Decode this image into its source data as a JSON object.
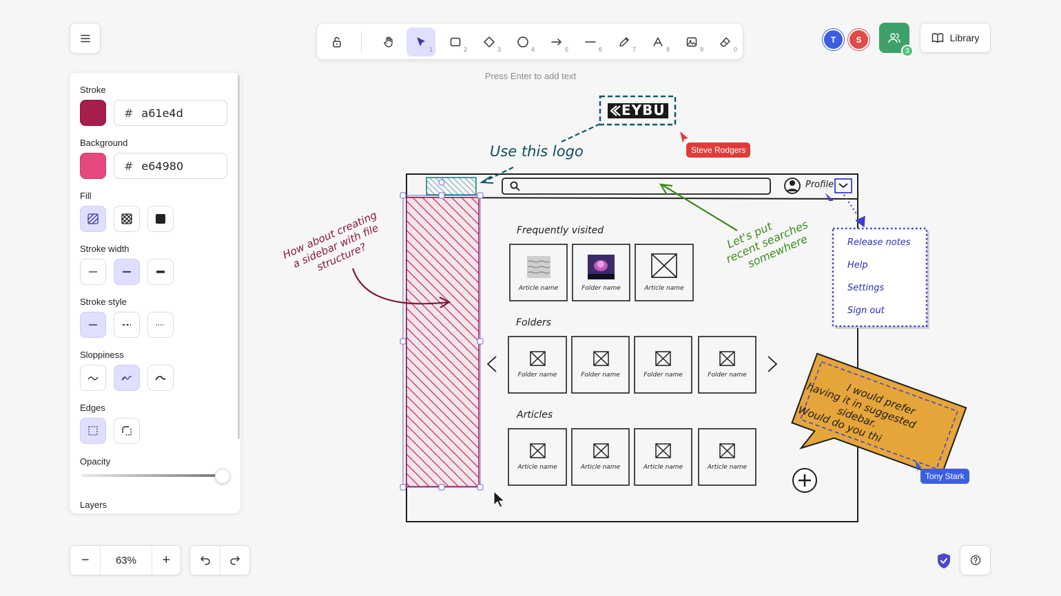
{
  "menu": {
    "icon": "hamburger-menu-icon"
  },
  "toolbar": {
    "tools": [
      {
        "name": "lock",
        "key": ""
      },
      {
        "name": "hand",
        "key": ""
      },
      {
        "name": "selection",
        "key": "1"
      },
      {
        "name": "rectangle",
        "key": "2"
      },
      {
        "name": "diamond",
        "key": "3"
      },
      {
        "name": "ellipse",
        "key": "4"
      },
      {
        "name": "arrow",
        "key": "5"
      },
      {
        "name": "line",
        "key": "6"
      },
      {
        "name": "draw",
        "key": "7"
      },
      {
        "name": "text",
        "key": "8"
      },
      {
        "name": "image",
        "key": "9"
      },
      {
        "name": "eraser",
        "key": "0"
      }
    ],
    "hint": "Press Enter to add text"
  },
  "collaborators": {
    "avatars": [
      {
        "initial": "T",
        "color": "#3b5fe0"
      },
      {
        "initial": "S",
        "color": "#e04b4b"
      }
    ],
    "share_count": "3",
    "share_color": "#3ea16b"
  },
  "library": {
    "label": "Library"
  },
  "panel": {
    "stroke_label": "Stroke",
    "stroke_hex": "a61e4d",
    "stroke_color": "#a61e4d",
    "background_label": "Background",
    "background_hex": "e64980",
    "background_color": "#e64980",
    "hash": "#",
    "fill_label": "Fill",
    "stroke_width_label": "Stroke width",
    "stroke_style_label": "Stroke style",
    "sloppiness_label": "Sloppiness",
    "edges_label": "Edges",
    "opacity_label": "Opacity",
    "opacity_value": 1.0,
    "layers_label": "Layers"
  },
  "zoom": {
    "value": "63%",
    "minus": "−",
    "plus": "+"
  },
  "canvas": {
    "logo_text": "EYBU",
    "use_logo": "Use this logo",
    "cursor_steve": "Steve Rodgers",
    "cursor_tony": "Tony Stark",
    "sidebar_note": [
      "How about creating",
      "a sidebar with file",
      "structure?"
    ],
    "searches_note": [
      "Let's put",
      "recent searches",
      "somewhere"
    ],
    "profile": "Profile",
    "dropdown": [
      "Release notes",
      "Help",
      "Settings",
      "Sign out"
    ],
    "sections": {
      "frequent": "Frequently visited",
      "folders": "Folders",
      "articles": "Articles"
    },
    "frequent_items": [
      "Article name",
      "Folder name",
      "Article name"
    ],
    "folder_items": [
      "Folder name",
      "Folder name",
      "Folder name",
      "Folder name"
    ],
    "article_items": [
      "Article name",
      "Article name",
      "Article name",
      "Article name"
    ],
    "sticky_note": [
      "I would prefer",
      "having it in suggested",
      "sidebar.",
      "Would do you thi"
    ]
  }
}
